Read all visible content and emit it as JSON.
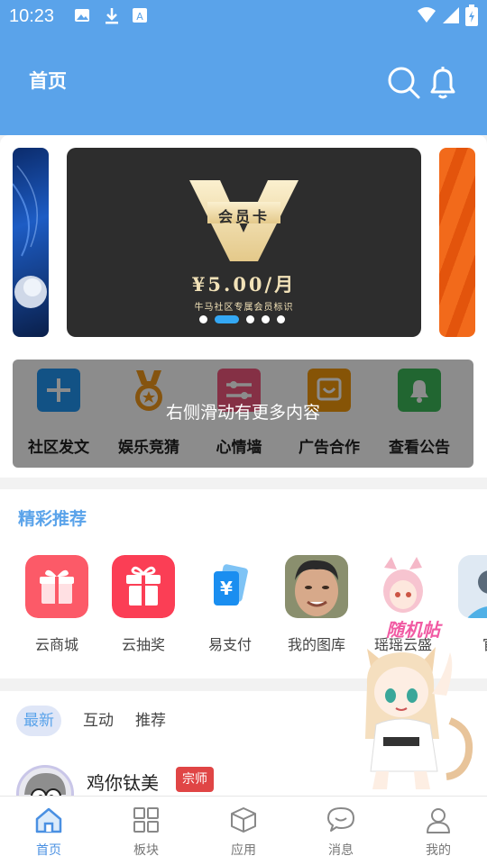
{
  "status_bar": {
    "time": "10:23"
  },
  "header": {
    "title": "首页",
    "search_icon": "search-icon",
    "bell_icon": "bell-icon"
  },
  "banner": {
    "vip_label": "会员卡",
    "price": "¥5.00/月",
    "description": "牛马社区专属会员标识",
    "slide_count": 5,
    "active_slide": 2
  },
  "quick_actions": {
    "items": [
      {
        "label": "社区发文",
        "icon": "plus-icon",
        "color": "#2196f3"
      },
      {
        "label": "娱乐竞猜",
        "icon": "medal-icon",
        "color": "#f29a1d"
      },
      {
        "label": "心情墙",
        "icon": "sliders-icon",
        "color": "#f2587f"
      },
      {
        "label": "广告合作",
        "icon": "ad-icon",
        "color": "#f59a0c"
      },
      {
        "label": "查看公告",
        "icon": "bell-icon",
        "color": "#3dbb5a"
      }
    ],
    "overlay_hint": "右侧滑动有更多内容"
  },
  "recommend": {
    "title": "精彩推荐",
    "items": [
      {
        "label": "云商城",
        "icon": "gift-icon"
      },
      {
        "label": "云抽奖",
        "icon": "gift-box-icon"
      },
      {
        "label": "易支付",
        "icon": "yen-card-icon"
      },
      {
        "label": "我的图库",
        "icon": "photo-avatar"
      },
      {
        "label": "瑶瑶云盛",
        "icon": "anime-avatar"
      },
      {
        "label": "官",
        "icon": "person-avatar"
      }
    ]
  },
  "feed": {
    "tabs": [
      {
        "label": "最新",
        "active": true
      },
      {
        "label": "互动",
        "active": false
      },
      {
        "label": "推荐",
        "active": false
      }
    ],
    "post": {
      "author": "鸡你钛美",
      "badge": "宗师"
    }
  },
  "floating": {
    "random_label": "随机帖",
    "mascot": "catgirl-mascot"
  },
  "bottom_nav": {
    "items": [
      {
        "label": "首页",
        "icon": "home-icon",
        "active": true
      },
      {
        "label": "板块",
        "icon": "grid-icon",
        "active": false
      },
      {
        "label": "应用",
        "icon": "box-icon",
        "active": false
      },
      {
        "label": "消息",
        "icon": "chat-icon",
        "active": false
      },
      {
        "label": "我的",
        "icon": "user-icon",
        "active": false
      }
    ]
  },
  "colors": {
    "primary": "#5aa3ea",
    "badge": "#e04545",
    "active_nav": "#4a90e2"
  }
}
